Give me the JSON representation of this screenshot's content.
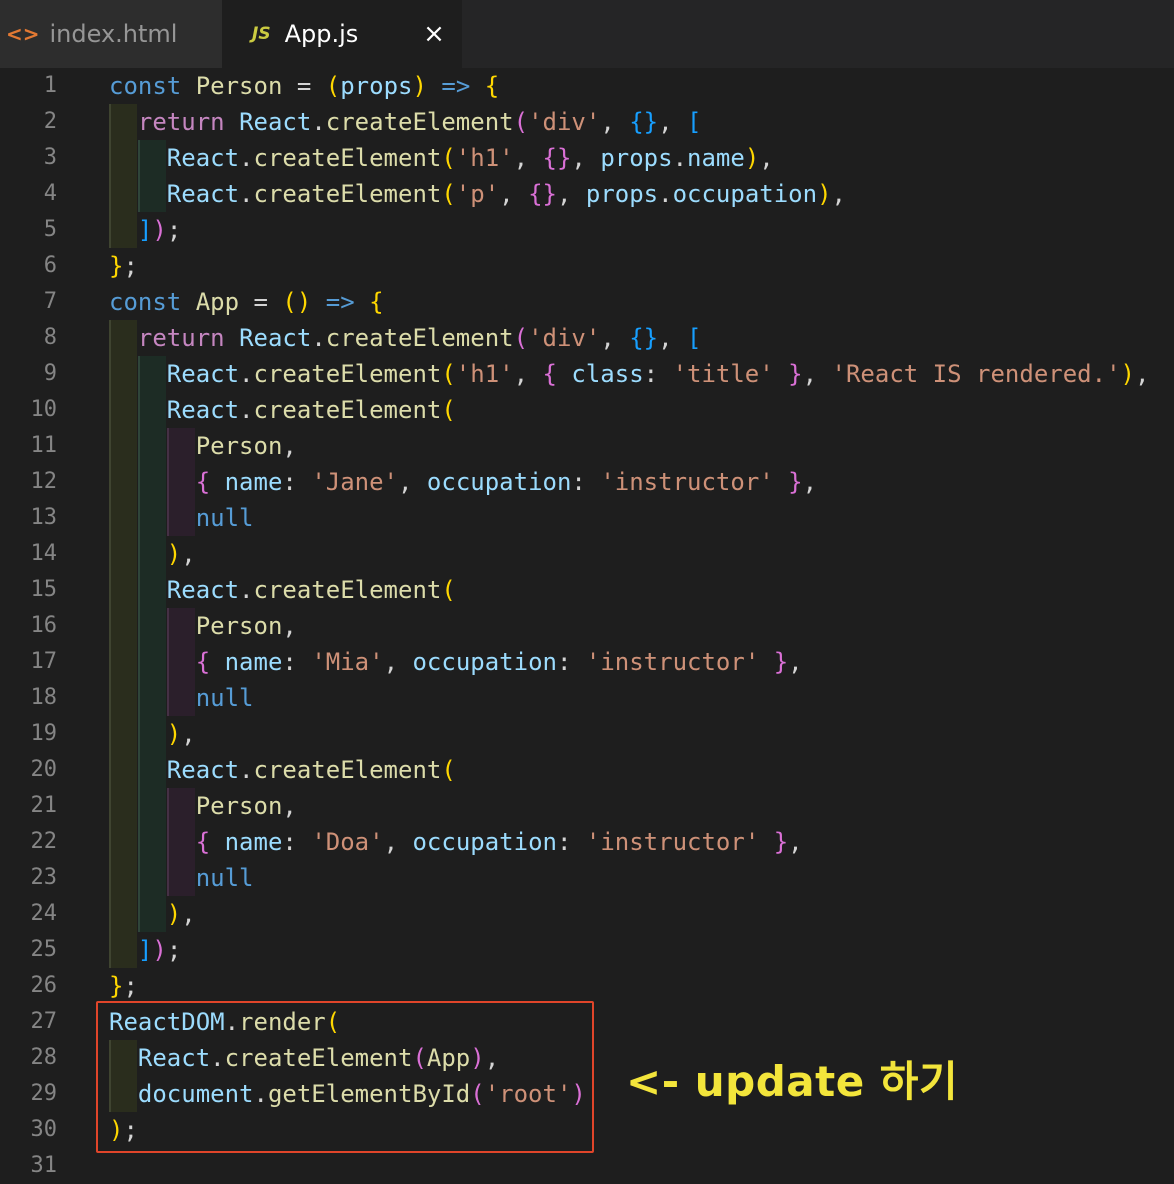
{
  "tabs": [
    {
      "icon": "<>",
      "label": "index.html",
      "active": false
    },
    {
      "icon": "JS",
      "label": "App.js",
      "active": true,
      "close": "×"
    }
  ],
  "line_numbers": [
    "1",
    "2",
    "3",
    "4",
    "5",
    "6",
    "7",
    "8",
    "9",
    "10",
    "11",
    "12",
    "13",
    "14",
    "15",
    "16",
    "17",
    "18",
    "19",
    "20",
    "21",
    "22",
    "23",
    "24",
    "25",
    "26",
    "27",
    "28",
    "29",
    "30",
    "31"
  ],
  "code_lines": [
    "const Person = (props) => {",
    "  return React.createElement('div', {}, [",
    "    React.createElement('h1', {}, props.name),",
    "    React.createElement('p', {}, props.occupation),",
    "  ]);",
    "};",
    "const App = () => {",
    "  return React.createElement('div', {}, [",
    "    React.createElement('h1', { class: 'title' }, 'React IS rendered.'),",
    "    React.createElement(",
    "      Person,",
    "      { name: 'Jane', occupation: 'instructor' },",
    "      null",
    "    ),",
    "    React.createElement(",
    "      Person,",
    "      { name: 'Mia', occupation: 'instructor' },",
    "      null",
    "    ),",
    "    React.createElement(",
    "      Person,",
    "      { name: 'Doa', occupation: 'instructor' },",
    "      null",
    "    ),",
    "  ]);",
    "};",
    "ReactDOM.render(",
    "  React.createElement(App),",
    "  document.getElementById('root')",
    ");"
  ],
  "annotation": "<- update 하기",
  "colors": {
    "highlight_box": "#e0452a",
    "annotation": "#f3e53b",
    "editor_bg": "#1e1e1e"
  }
}
